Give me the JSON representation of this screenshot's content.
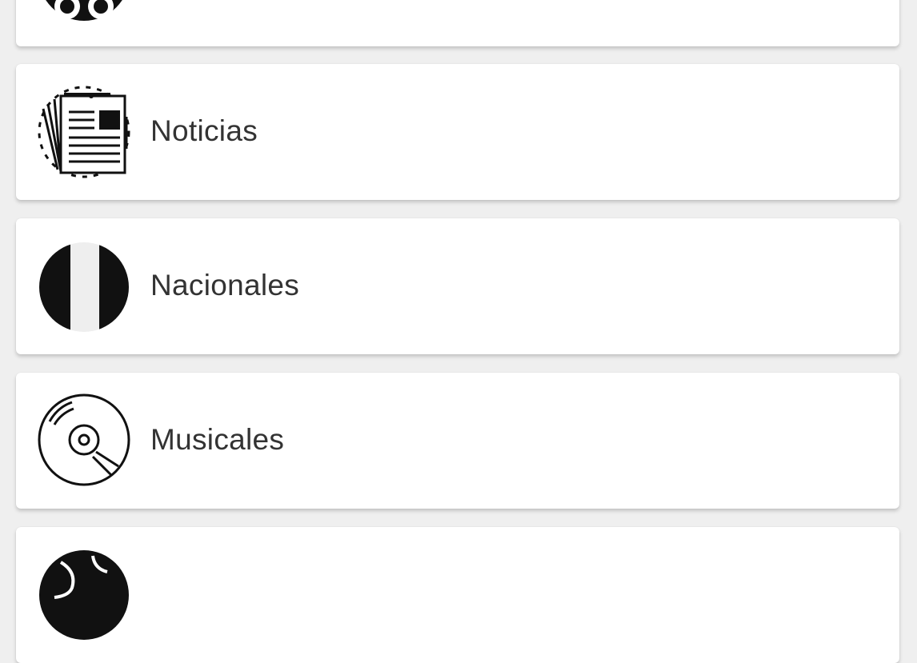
{
  "categories": [
    {
      "label": "",
      "icon": "binoculars-icon"
    },
    {
      "label": "Noticias",
      "icon": "newspaper-icon"
    },
    {
      "label": "Nacionales",
      "icon": "flag-icon"
    },
    {
      "label": "Musicales",
      "icon": "cd-disc-icon"
    },
    {
      "label": "",
      "icon": "globe-icon"
    }
  ],
  "colors": {
    "background": "#efefef",
    "card": "#ffffff",
    "text": "#333333",
    "icon": "#111111"
  }
}
